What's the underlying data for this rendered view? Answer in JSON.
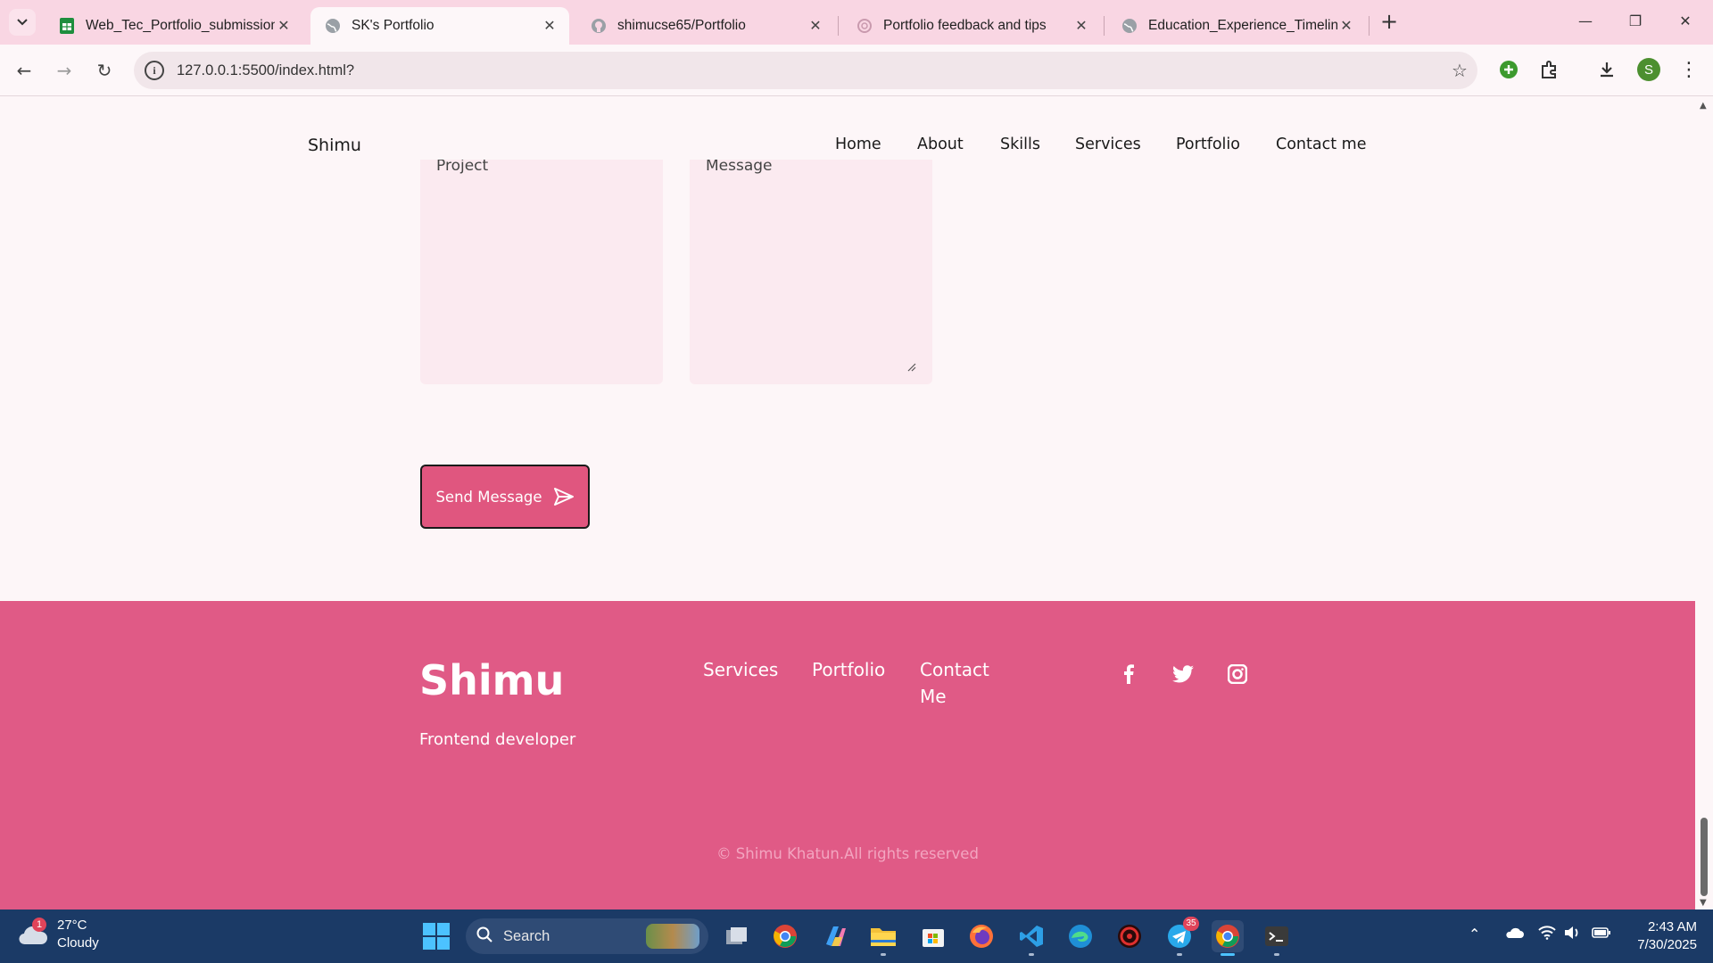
{
  "browser": {
    "tabs": [
      {
        "title": "Web_Tec_Portfolio_submission",
        "favicon": "sheets-icon",
        "active": false
      },
      {
        "title": "SK's Portfolio",
        "favicon": "globe-icon",
        "active": true
      },
      {
        "title": "shimucse65/Portfolio",
        "favicon": "github-icon",
        "active": false
      },
      {
        "title": "Portfolio feedback and tips",
        "favicon": "chatgpt-icon",
        "active": false
      },
      {
        "title": "Education_Experience_Timeline",
        "favicon": "globe-icon",
        "active": false
      }
    ],
    "url": "127.0.0.1:5500/index.html?",
    "profile_initial": "S",
    "accent": "#f9d6e3"
  },
  "site": {
    "brand": "Shimu",
    "nav": [
      "Home",
      "About",
      "Skills",
      "Services",
      "Portfolio",
      "Contact me"
    ],
    "form": {
      "project_placeholder": "Project",
      "message_placeholder": "Message",
      "send_label": "Send Message"
    },
    "footer": {
      "brand": "Shimu",
      "role": "Frontend developer",
      "links": [
        "Services",
        "Portfolio",
        "Contact",
        "Me"
      ],
      "social": [
        "facebook-icon",
        "twitter-icon",
        "instagram-icon"
      ],
      "copyright": "© Shimu Khatun.All rights reserved"
    },
    "colors": {
      "primary": "#e05a86",
      "background": "#fdf6f8",
      "field": "#fbeaf0"
    }
  },
  "taskbar": {
    "weather": {
      "temp": "27°C",
      "condition": "Cloudy",
      "badge": "1"
    },
    "search_placeholder": "Search",
    "telegram_badge": "35",
    "time": "2:43 AM",
    "date": "7/30/2025"
  }
}
